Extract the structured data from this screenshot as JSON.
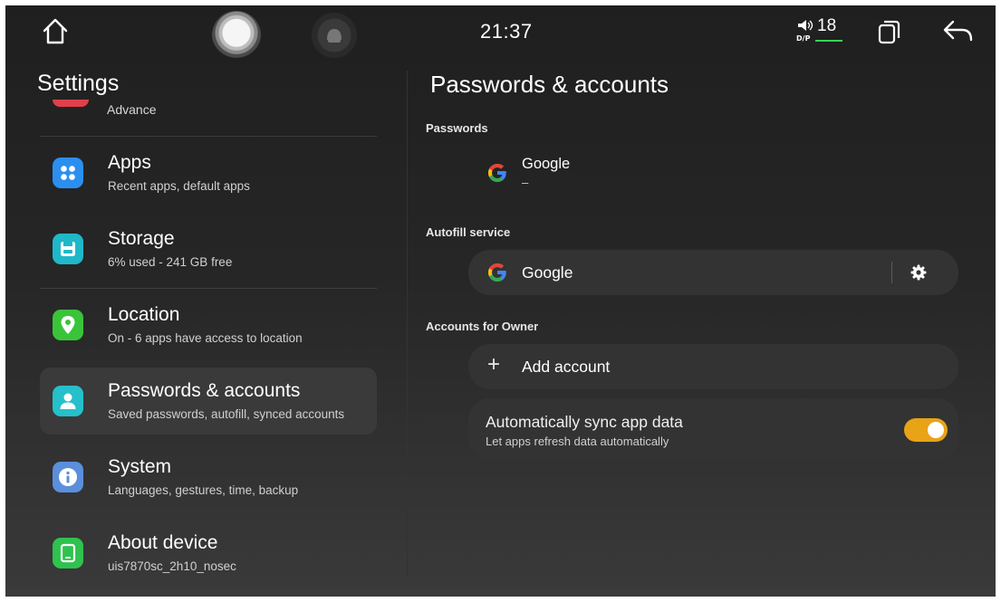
{
  "status_bar": {
    "time": "21:37",
    "volume_level": "18",
    "icons": [
      "home-icon",
      "assistant-icon",
      "bluetooth-phone-icon",
      "volume-icon",
      "recents-icon",
      "back-icon"
    ],
    "accent": "#39d353"
  },
  "sidebar": {
    "title": "Settings",
    "advance_label": "Advance",
    "items": [
      {
        "title": "Apps",
        "subtitle": "Recent apps, default apps",
        "icon": "apps-icon",
        "color": "#2b8ff0"
      },
      {
        "title": "Storage",
        "subtitle": "6% used - 241 GB free",
        "icon": "storage-icon",
        "color": "#1fb8c9"
      },
      {
        "title": "Location",
        "subtitle": "On - 6 apps have access to location",
        "icon": "location-icon",
        "color": "#3ac43a"
      },
      {
        "title": "Passwords & accounts",
        "subtitle": "Saved passwords, autofill, synced accounts",
        "icon": "accounts-icon",
        "color": "#25c0c9"
      },
      {
        "title": "System",
        "subtitle": "Languages, gestures, time, backup",
        "icon": "info-icon",
        "color": "#5b8fdc"
      },
      {
        "title": "About device",
        "subtitle": "uis7870sc_2h10_nosec",
        "icon": "device-icon",
        "color": "#2fc24f"
      }
    ],
    "selected": "Passwords & accounts"
  },
  "main": {
    "title": "Passwords & accounts",
    "passwords_section": "Passwords",
    "password_provider": {
      "name": "Google",
      "detail": "–"
    },
    "autofill_section": "Autofill service",
    "autofill_provider": "Google",
    "accounts_section": "Accounts for Owner",
    "add_account_label": "Add account",
    "sync": {
      "title": "Automatically sync app data",
      "subtitle": "Let apps refresh data automatically",
      "enabled": true,
      "toggle_color": "#e8a317"
    }
  }
}
